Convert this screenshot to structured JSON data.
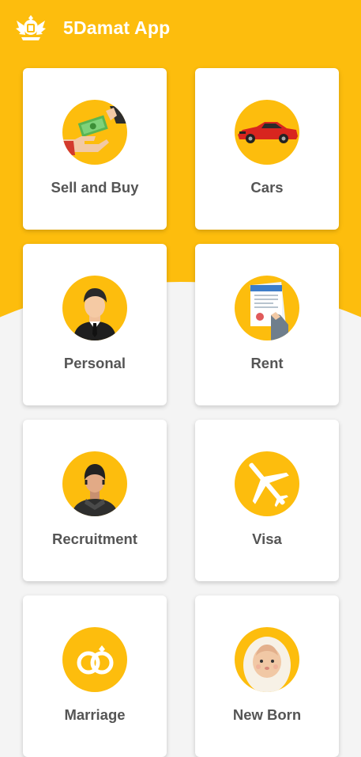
{
  "app_bar": {
    "title": "5Damat App",
    "logo_icon": "eagle-emblem-icon"
  },
  "colors": {
    "primary": "#fdbd0d",
    "background": "#f4f4f4",
    "card": "#ffffff",
    "label": "#555555"
  },
  "categories": [
    {
      "label": "Sell and Buy",
      "icon": "money-exchange-icon"
    },
    {
      "label": "Cars",
      "icon": "sports-car-icon"
    },
    {
      "label": "Personal",
      "icon": "businessman-icon"
    },
    {
      "label": "Rent",
      "icon": "contract-document-icon"
    },
    {
      "label": "Recruitment",
      "icon": "worker-icon"
    },
    {
      "label": "Visa",
      "icon": "airplane-icon"
    },
    {
      "label": "Marriage",
      "icon": "wedding-rings-icon"
    },
    {
      "label": "New Born",
      "icon": "baby-icon"
    }
  ]
}
